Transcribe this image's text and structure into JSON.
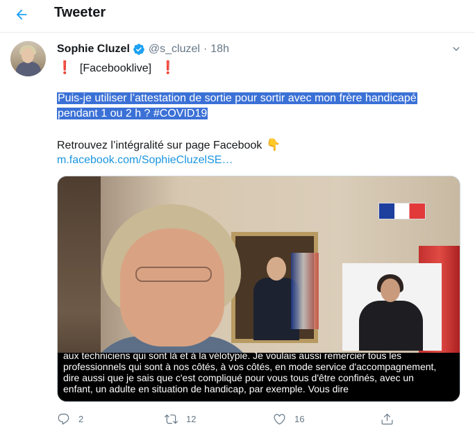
{
  "header": {
    "title": "Tweeter"
  },
  "tweet": {
    "author": "Sophie Cluzel",
    "handle": "@s_cluzel",
    "separator": "·",
    "time": "18h",
    "line1": "[Facebooklive]",
    "bang": "❗",
    "highlight_line1": "Puis-je utiliser l’attestation de sortie pour sortir avec mon frère handicapé",
    "highlight_line2": "pendant 1 ou 2 h ? #COVID19",
    "line3": "Retrouvez l’intégralité sur page Facebook",
    "point_emoji": "👇",
    "link": "m.facebook.com/SophieCluzelSE…"
  },
  "video": {
    "subtitles": [
      "aux techniciens qui sont là et à la vélotypie. Je voulais aussi remercier tous les",
      "professionnels qui sont à nos côtés, à vos côtés, en mode service d'accompagnement,",
      "dire aussi que je sais que c'est compliqué pour vous tous d'être confinés, avec un",
      "enfant, un adulte en situation de handicap, par exemple. Vous dire"
    ]
  },
  "actions": {
    "reply_count": "2",
    "retweet_count": "12",
    "like_count": "16"
  },
  "colors": {
    "accent": "#1da1f2",
    "link": "#1b95e0",
    "highlight": "#3b71d6",
    "muted": "#657786"
  },
  "icons": [
    "back-arrow-icon",
    "verified-badge-icon",
    "chevron-down-icon",
    "reply-icon",
    "retweet-icon",
    "like-icon",
    "share-icon"
  ]
}
